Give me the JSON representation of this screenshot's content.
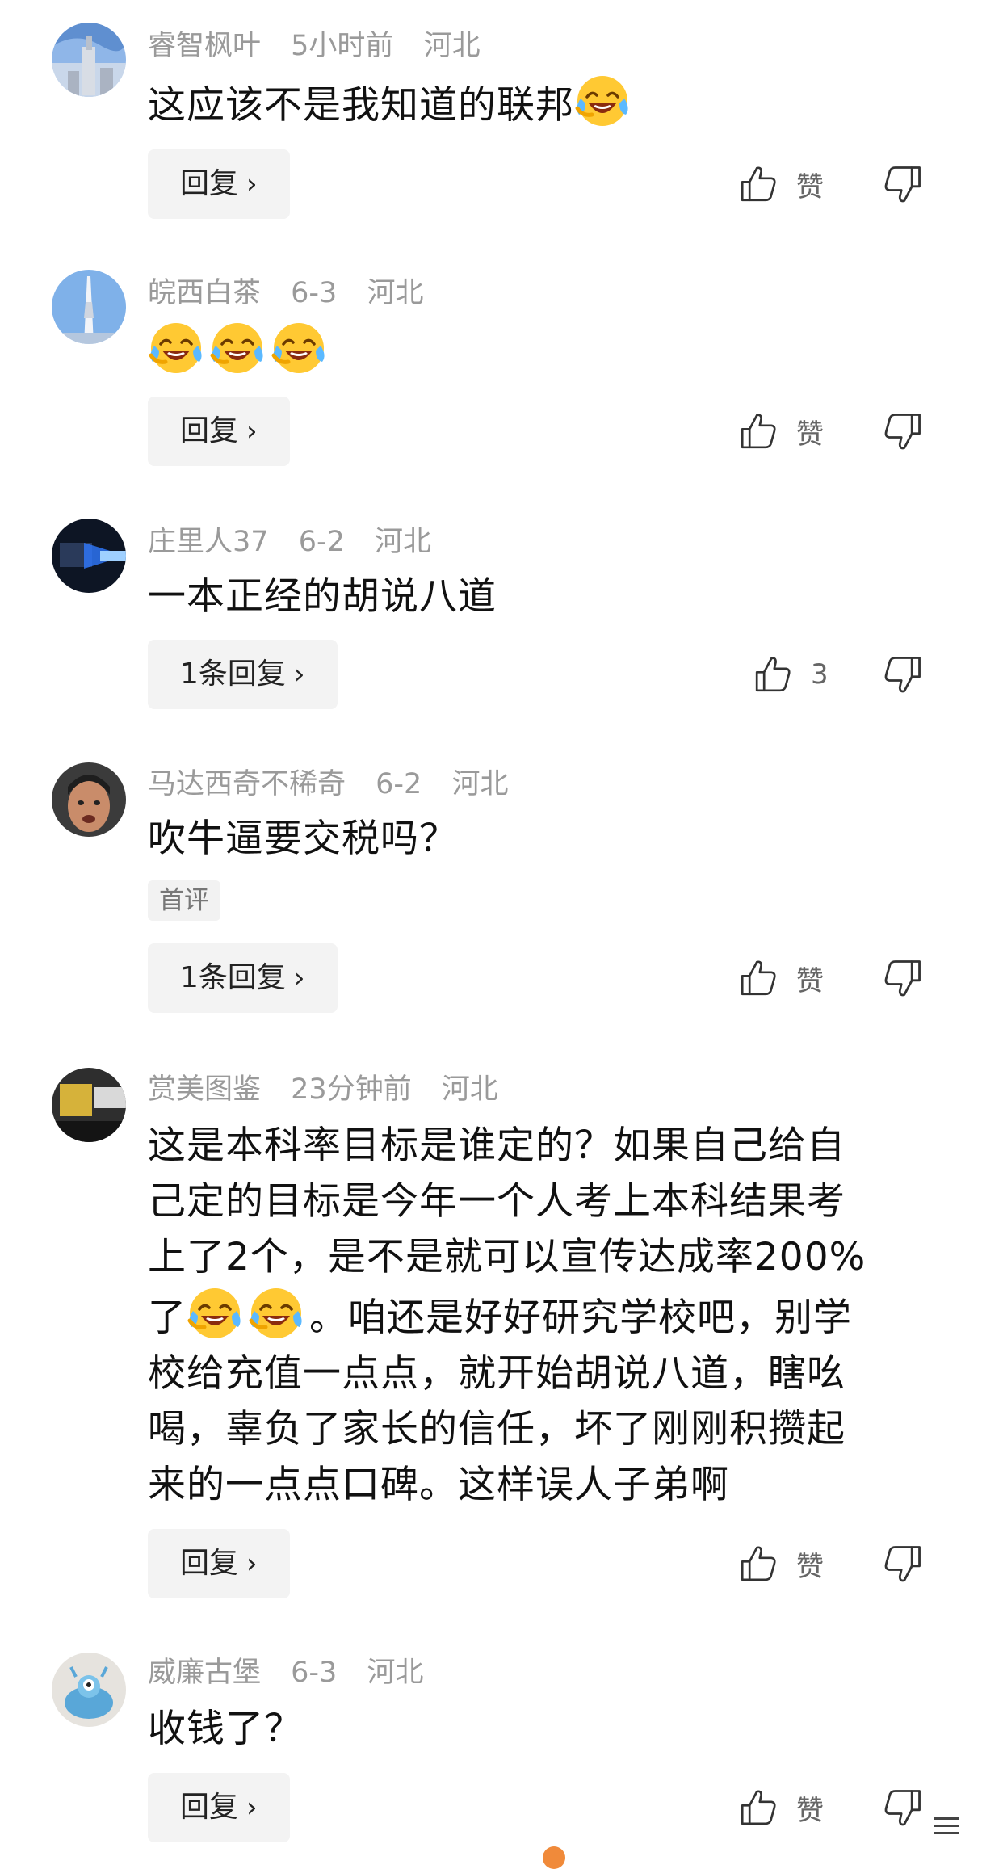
{
  "comments": [
    {
      "user": "睿智枫叶",
      "time": "5小时前",
      "location": "河北",
      "text": "这应该不是我知道的联邦",
      "emoji_count": 1,
      "reply_label": "回复",
      "like_label": "赞",
      "avatar": "tower-avatar"
    },
    {
      "user": "皖西白茶",
      "time": "6-3",
      "location": "河北",
      "text": "",
      "emoji_count": 3,
      "reply_label": "回复",
      "like_label": "赞",
      "avatar": "canton-tower-avatar"
    },
    {
      "user": "庄里人37",
      "time": "6-2",
      "location": "河北",
      "text": "一本正经的胡说八道",
      "emoji_count": 0,
      "reply_label": "1条回复",
      "like_label": "3",
      "avatar": "tech-avatar"
    },
    {
      "user": "马达西奇不稀奇",
      "time": "6-2",
      "location": "河北",
      "text": "吹牛逼要交税吗？",
      "emoji_count": 0,
      "tag": "首评",
      "reply_label": "1条回复",
      "like_label": "赞",
      "avatar": "face-avatar"
    },
    {
      "user": "赏美图鉴",
      "time": "23分钟前",
      "location": "河北",
      "text_lines": [
        "这是本科率目标是谁定的？如果自己给自",
        "己定的目标是今年一个人考上本科结果考",
        "上了2个，是不是就可以宣传达成率200%",
        "。咱还是好好研究学校吧，别学",
        "校给充值一点点，就开始胡说八道，瞎吆",
        "喝，辜负了家长的信任，坏了刚刚积攒起",
        "来的一点点口碑。这样误人子弟啊"
      ],
      "line4_prefix": "了",
      "reply_label": "回复",
      "like_label": "赞",
      "avatar": "desk-avatar"
    },
    {
      "user": "威廉古堡",
      "time": "6-3",
      "location": "河北",
      "text": "收钱了？",
      "emoji_count": 0,
      "reply_label": "回复",
      "like_label": "赞",
      "avatar": "alien-avatar"
    }
  ],
  "icons": {
    "like": "thumb-up-icon",
    "dislike": "thumb-down-icon",
    "reply_chevron": "chevron-right-icon",
    "emoji": "laugh-cry-emoji"
  },
  "colors": {
    "meta": "#9a9a9a",
    "button_bg": "#f3f3f3",
    "accent_dot": "#f08a3a"
  }
}
